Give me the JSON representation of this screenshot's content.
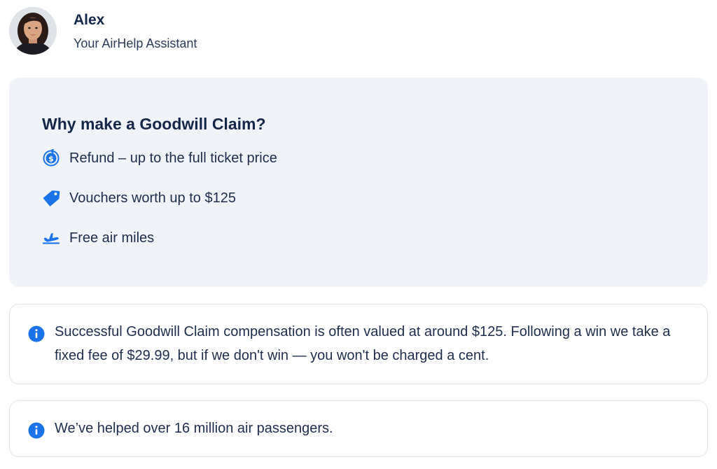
{
  "assistant": {
    "name": "Alex",
    "role": "Your AirHelp Assistant"
  },
  "benefits": {
    "title": "Why make a Goodwill Claim?",
    "items": [
      {
        "icon": "refund-dollar-icon",
        "label": "Refund – up to the full ticket price"
      },
      {
        "icon": "voucher-tag-icon",
        "label": "Vouchers worth up to $125"
      },
      {
        "icon": "airplane-icon",
        "label": "Free air miles"
      }
    ]
  },
  "info_cards": [
    {
      "icon": "info-icon",
      "text": "Successful Goodwill Claim compensation is often valued at around $125. Following a win we take a fixed fee of $29.99, but if we don't win — you won't be charged a cent."
    },
    {
      "icon": "info-icon",
      "text": "We’ve helped over 16 million air passengers."
    }
  ],
  "colors": {
    "accent": "#1a73e8",
    "heading": "#14264a",
    "card_background": "#f0f3f8",
    "border": "#dfe3ea"
  }
}
